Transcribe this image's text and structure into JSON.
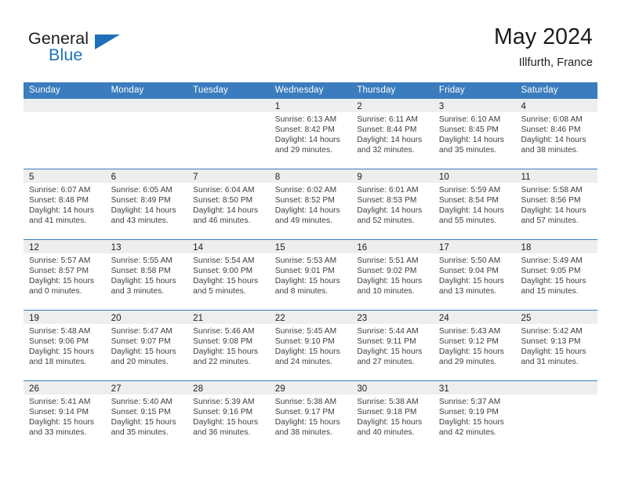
{
  "brand": {
    "name_top": "General",
    "name_bottom": "Blue",
    "logo_icon": "triangle-logo-icon",
    "accent_color": "#1d6fb8"
  },
  "header": {
    "title": "May 2024",
    "location": "Illfurth, France"
  },
  "theme": {
    "header_blue": "#3a7cbe",
    "daynum_band": "#eeeeee",
    "text": "#1c1c1c"
  },
  "weekdays": [
    "Sunday",
    "Monday",
    "Tuesday",
    "Wednesday",
    "Thursday",
    "Friday",
    "Saturday"
  ],
  "weeks": [
    [
      {
        "day": "",
        "sunrise": "",
        "sunset": "",
        "daylight1": "",
        "daylight2": "",
        "empty": true
      },
      {
        "day": "",
        "sunrise": "",
        "sunset": "",
        "daylight1": "",
        "daylight2": "",
        "empty": true
      },
      {
        "day": "",
        "sunrise": "",
        "sunset": "",
        "daylight1": "",
        "daylight2": "",
        "empty": true
      },
      {
        "day": "1",
        "sunrise": "Sunrise: 6:13 AM",
        "sunset": "Sunset: 8:42 PM",
        "daylight1": "Daylight: 14 hours",
        "daylight2": "and 29 minutes.",
        "empty": false
      },
      {
        "day": "2",
        "sunrise": "Sunrise: 6:11 AM",
        "sunset": "Sunset: 8:44 PM",
        "daylight1": "Daylight: 14 hours",
        "daylight2": "and 32 minutes.",
        "empty": false
      },
      {
        "day": "3",
        "sunrise": "Sunrise: 6:10 AM",
        "sunset": "Sunset: 8:45 PM",
        "daylight1": "Daylight: 14 hours",
        "daylight2": "and 35 minutes.",
        "empty": false
      },
      {
        "day": "4",
        "sunrise": "Sunrise: 6:08 AM",
        "sunset": "Sunset: 8:46 PM",
        "daylight1": "Daylight: 14 hours",
        "daylight2": "and 38 minutes.",
        "empty": false
      }
    ],
    [
      {
        "day": "5",
        "sunrise": "Sunrise: 6:07 AM",
        "sunset": "Sunset: 8:48 PM",
        "daylight1": "Daylight: 14 hours",
        "daylight2": "and 41 minutes.",
        "empty": false
      },
      {
        "day": "6",
        "sunrise": "Sunrise: 6:05 AM",
        "sunset": "Sunset: 8:49 PM",
        "daylight1": "Daylight: 14 hours",
        "daylight2": "and 43 minutes.",
        "empty": false
      },
      {
        "day": "7",
        "sunrise": "Sunrise: 6:04 AM",
        "sunset": "Sunset: 8:50 PM",
        "daylight1": "Daylight: 14 hours",
        "daylight2": "and 46 minutes.",
        "empty": false
      },
      {
        "day": "8",
        "sunrise": "Sunrise: 6:02 AM",
        "sunset": "Sunset: 8:52 PM",
        "daylight1": "Daylight: 14 hours",
        "daylight2": "and 49 minutes.",
        "empty": false
      },
      {
        "day": "9",
        "sunrise": "Sunrise: 6:01 AM",
        "sunset": "Sunset: 8:53 PM",
        "daylight1": "Daylight: 14 hours",
        "daylight2": "and 52 minutes.",
        "empty": false
      },
      {
        "day": "10",
        "sunrise": "Sunrise: 5:59 AM",
        "sunset": "Sunset: 8:54 PM",
        "daylight1": "Daylight: 14 hours",
        "daylight2": "and 55 minutes.",
        "empty": false
      },
      {
        "day": "11",
        "sunrise": "Sunrise: 5:58 AM",
        "sunset": "Sunset: 8:56 PM",
        "daylight1": "Daylight: 14 hours",
        "daylight2": "and 57 minutes.",
        "empty": false
      }
    ],
    [
      {
        "day": "12",
        "sunrise": "Sunrise: 5:57 AM",
        "sunset": "Sunset: 8:57 PM",
        "daylight1": "Daylight: 15 hours",
        "daylight2": "and 0 minutes.",
        "empty": false
      },
      {
        "day": "13",
        "sunrise": "Sunrise: 5:55 AM",
        "sunset": "Sunset: 8:58 PM",
        "daylight1": "Daylight: 15 hours",
        "daylight2": "and 3 minutes.",
        "empty": false
      },
      {
        "day": "14",
        "sunrise": "Sunrise: 5:54 AM",
        "sunset": "Sunset: 9:00 PM",
        "daylight1": "Daylight: 15 hours",
        "daylight2": "and 5 minutes.",
        "empty": false
      },
      {
        "day": "15",
        "sunrise": "Sunrise: 5:53 AM",
        "sunset": "Sunset: 9:01 PM",
        "daylight1": "Daylight: 15 hours",
        "daylight2": "and 8 minutes.",
        "empty": false
      },
      {
        "day": "16",
        "sunrise": "Sunrise: 5:51 AM",
        "sunset": "Sunset: 9:02 PM",
        "daylight1": "Daylight: 15 hours",
        "daylight2": "and 10 minutes.",
        "empty": false
      },
      {
        "day": "17",
        "sunrise": "Sunrise: 5:50 AM",
        "sunset": "Sunset: 9:04 PM",
        "daylight1": "Daylight: 15 hours",
        "daylight2": "and 13 minutes.",
        "empty": false
      },
      {
        "day": "18",
        "sunrise": "Sunrise: 5:49 AM",
        "sunset": "Sunset: 9:05 PM",
        "daylight1": "Daylight: 15 hours",
        "daylight2": "and 15 minutes.",
        "empty": false
      }
    ],
    [
      {
        "day": "19",
        "sunrise": "Sunrise: 5:48 AM",
        "sunset": "Sunset: 9:06 PM",
        "daylight1": "Daylight: 15 hours",
        "daylight2": "and 18 minutes.",
        "empty": false
      },
      {
        "day": "20",
        "sunrise": "Sunrise: 5:47 AM",
        "sunset": "Sunset: 9:07 PM",
        "daylight1": "Daylight: 15 hours",
        "daylight2": "and 20 minutes.",
        "empty": false
      },
      {
        "day": "21",
        "sunrise": "Sunrise: 5:46 AM",
        "sunset": "Sunset: 9:08 PM",
        "daylight1": "Daylight: 15 hours",
        "daylight2": "and 22 minutes.",
        "empty": false
      },
      {
        "day": "22",
        "sunrise": "Sunrise: 5:45 AM",
        "sunset": "Sunset: 9:10 PM",
        "daylight1": "Daylight: 15 hours",
        "daylight2": "and 24 minutes.",
        "empty": false
      },
      {
        "day": "23",
        "sunrise": "Sunrise: 5:44 AM",
        "sunset": "Sunset: 9:11 PM",
        "daylight1": "Daylight: 15 hours",
        "daylight2": "and 27 minutes.",
        "empty": false
      },
      {
        "day": "24",
        "sunrise": "Sunrise: 5:43 AM",
        "sunset": "Sunset: 9:12 PM",
        "daylight1": "Daylight: 15 hours",
        "daylight2": "and 29 minutes.",
        "empty": false
      },
      {
        "day": "25",
        "sunrise": "Sunrise: 5:42 AM",
        "sunset": "Sunset: 9:13 PM",
        "daylight1": "Daylight: 15 hours",
        "daylight2": "and 31 minutes.",
        "empty": false
      }
    ],
    [
      {
        "day": "26",
        "sunrise": "Sunrise: 5:41 AM",
        "sunset": "Sunset: 9:14 PM",
        "daylight1": "Daylight: 15 hours",
        "daylight2": "and 33 minutes.",
        "empty": false
      },
      {
        "day": "27",
        "sunrise": "Sunrise: 5:40 AM",
        "sunset": "Sunset: 9:15 PM",
        "daylight1": "Daylight: 15 hours",
        "daylight2": "and 35 minutes.",
        "empty": false
      },
      {
        "day": "28",
        "sunrise": "Sunrise: 5:39 AM",
        "sunset": "Sunset: 9:16 PM",
        "daylight1": "Daylight: 15 hours",
        "daylight2": "and 36 minutes.",
        "empty": false
      },
      {
        "day": "29",
        "sunrise": "Sunrise: 5:38 AM",
        "sunset": "Sunset: 9:17 PM",
        "daylight1": "Daylight: 15 hours",
        "daylight2": "and 38 minutes.",
        "empty": false
      },
      {
        "day": "30",
        "sunrise": "Sunrise: 5:38 AM",
        "sunset": "Sunset: 9:18 PM",
        "daylight1": "Daylight: 15 hours",
        "daylight2": "and 40 minutes.",
        "empty": false
      },
      {
        "day": "31",
        "sunrise": "Sunrise: 5:37 AM",
        "sunset": "Sunset: 9:19 PM",
        "daylight1": "Daylight: 15 hours",
        "daylight2": "and 42 minutes.",
        "empty": false
      },
      {
        "day": "",
        "sunrise": "",
        "sunset": "",
        "daylight1": "",
        "daylight2": "",
        "empty": true
      }
    ]
  ]
}
